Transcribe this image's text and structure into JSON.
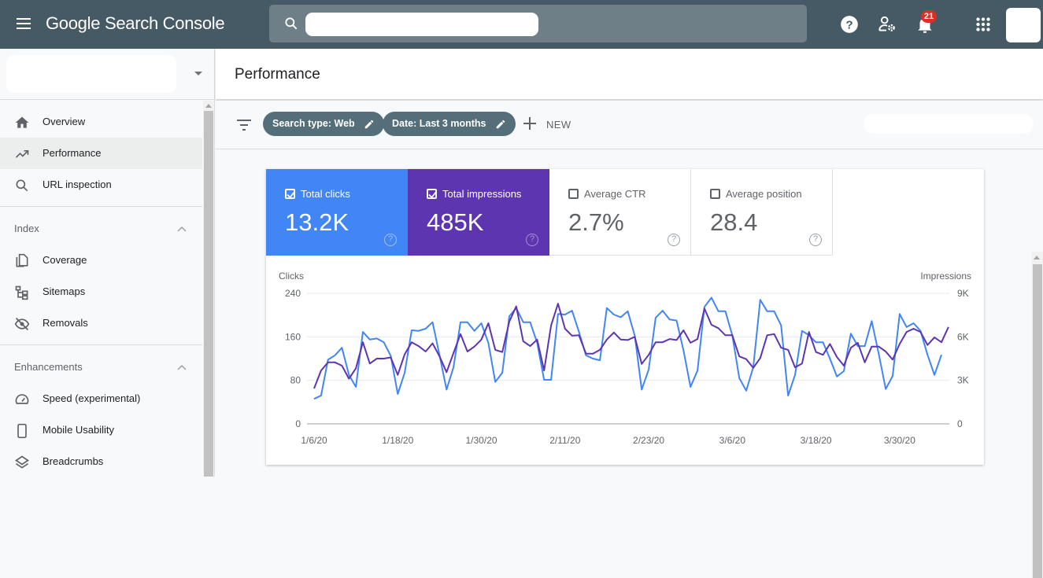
{
  "app": {
    "title_google": "Google",
    "title_rest": "Search Console",
    "notification_count": "21",
    "search_placeholder": ""
  },
  "sidebar": {
    "property_value": "",
    "top_items": [
      {
        "label": "Overview",
        "icon": "home-icon"
      },
      {
        "label": "Performance",
        "icon": "trending-up-icon",
        "active": true
      },
      {
        "label": "URL inspection",
        "icon": "search-icon"
      }
    ],
    "sections": [
      {
        "title": "Index",
        "items": [
          {
            "label": "Coverage",
            "icon": "coverage-icon"
          },
          {
            "label": "Sitemaps",
            "icon": "sitemap-icon"
          },
          {
            "label": "Removals",
            "icon": "eye-off-icon"
          }
        ]
      },
      {
        "title": "Enhancements",
        "items": [
          {
            "label": "Speed (experimental)",
            "icon": "speedometer-icon"
          },
          {
            "label": "Mobile Usability",
            "icon": "phone-icon"
          },
          {
            "label": "Breadcrumbs",
            "icon": "layers-icon"
          }
        ]
      }
    ]
  },
  "page": {
    "title": "Performance",
    "filters": [
      {
        "label": "Search type: Web"
      },
      {
        "label": "Date: Last 3 months"
      }
    ],
    "new_label": "NEW"
  },
  "metrics": [
    {
      "label": "Total clicks",
      "value": "13.2K",
      "checked": true,
      "color": "#4285f4"
    },
    {
      "label": "Total impressions",
      "value": "485K",
      "checked": true,
      "color": "#5e35b1"
    },
    {
      "label": "Average CTR",
      "value": "2.7%",
      "checked": false
    },
    {
      "label": "Average position",
      "value": "28.4",
      "checked": false
    }
  ],
  "chart_data": {
    "type": "line",
    "x_start": "2020-01-06",
    "x_tick_labels": [
      "1/6/20",
      "1/18/20",
      "1/30/20",
      "2/11/20",
      "2/23/20",
      "3/6/20",
      "3/18/20",
      "3/30/20"
    ],
    "x_tick_day_offsets": [
      0,
      12,
      24,
      36,
      48,
      60,
      72,
      84
    ],
    "left_axis": {
      "label": "Clicks",
      "ticks": [
        "0",
        "80",
        "160",
        "240"
      ],
      "tick_values": [
        0,
        80,
        160,
        240
      ],
      "range": [
        0,
        240
      ]
    },
    "right_axis": {
      "label": "Impressions",
      "ticks": [
        "0",
        "3K",
        "6K",
        "9K"
      ],
      "tick_values": [
        0,
        3000,
        6000,
        9000
      ],
      "range": [
        0,
        9000
      ]
    },
    "grid": true,
    "series": [
      {
        "name": "Clicks",
        "axis": "left",
        "color": "#4285f4",
        "values": [
          46,
          52,
          118,
          126,
          140,
          90,
          68,
          169,
          155,
          157,
          150,
          125,
          55,
          94,
          172,
          171,
          175,
          187,
          126,
          63,
          104,
          187,
          187,
          171,
          185,
          149,
          77,
          94,
          198,
          213,
          187,
          187,
          149,
          81,
          81,
          202,
          201,
          208,
          169,
          126,
          120,
          117,
          213,
          201,
          196,
          207,
          162,
          63,
          100,
          195,
          208,
          192,
          190,
          135,
          68,
          98,
          215,
          232,
          207,
          207,
          163,
          84,
          61,
          104,
          228,
          207,
          207,
          181,
          52,
          90,
          171,
          163,
          150,
          150,
          120,
          87,
          97,
          166,
          143,
          143,
          189,
          129,
          64,
          88,
          202,
          178,
          185,
          171,
          127,
          90,
          127
        ]
      },
      {
        "name": "Impressions",
        "axis": "right",
        "color": "#5e35b1",
        "values": [
          2440,
          3680,
          4240,
          4240,
          4010,
          3110,
          3830,
          5630,
          4160,
          4500,
          4500,
          4580,
          3380,
          4800,
          5630,
          5360,
          4990,
          5550,
          4650,
          3560,
          4880,
          6190,
          4990,
          5330,
          5810,
          6940,
          5100,
          4950,
          7050,
          8100,
          5700,
          5360,
          5810,
          3680,
          6790,
          8290,
          6560,
          6080,
          6110,
          4840,
          4840,
          5100,
          5810,
          6300,
          5810,
          5780,
          6000,
          4130,
          4760,
          5630,
          5630,
          5850,
          5780,
          6450,
          5590,
          5850,
          7950,
          6830,
          6600,
          6110,
          6110,
          4650,
          4460,
          3860,
          4540,
          6110,
          6190,
          5250,
          5100,
          3900,
          4160,
          6340,
          4950,
          4760,
          5510,
          4610,
          4010,
          5250,
          5590,
          4240,
          5330,
          5330,
          4990,
          4430,
          5510,
          6340,
          6560,
          6340,
          5440,
          5960,
          5630,
          6680
        ]
      }
    ]
  }
}
